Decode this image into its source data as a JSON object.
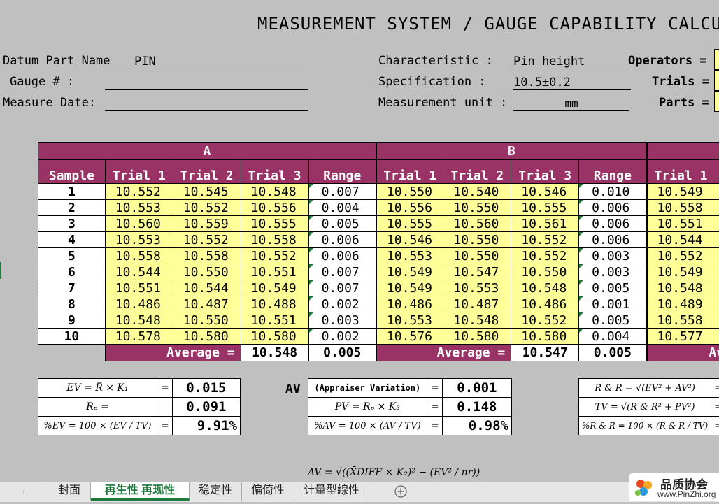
{
  "title": "MEASUREMENT SYSTEM / GAUGE CAPABILITY CALCUL",
  "header": {
    "datum_label": "Datum Part Name",
    "datum_value": "PIN",
    "gauge_label": "Gauge # :",
    "gauge_value": "",
    "date_label": "Measure Date:",
    "date_value": "",
    "char_label": "Characteristic :",
    "char_value": "Pin height",
    "spec_label": "Specification :",
    "spec_value": "10.5±0.2",
    "unit_label": "Measurement unit :",
    "unit_value": "mm",
    "operators_label": "Operators =",
    "trials_label": "Trials =",
    "parts_label": "Parts ="
  },
  "table": {
    "group_a": "A",
    "group_b": "B",
    "col_sample": "Sample",
    "col_trial1": "Trial 1",
    "col_trial2": "Trial 2",
    "col_trial3": "Trial 3",
    "col_range": "Range",
    "rows": [
      {
        "s": "1",
        "a1": "10.552",
        "a2": "10.545",
        "a3": "10.548",
        "ar": "0.007",
        "b1": "10.550",
        "b2": "10.540",
        "b3": "10.546",
        "br": "0.010",
        "c1": "10.549"
      },
      {
        "s": "2",
        "a1": "10.553",
        "a2": "10.552",
        "a3": "10.556",
        "ar": "0.004",
        "b1": "10.556",
        "b2": "10.550",
        "b3": "10.555",
        "br": "0.006",
        "c1": "10.558"
      },
      {
        "s": "3",
        "a1": "10.560",
        "a2": "10.559",
        "a3": "10.555",
        "ar": "0.005",
        "b1": "10.555",
        "b2": "10.560",
        "b3": "10.561",
        "br": "0.006",
        "c1": "10.551"
      },
      {
        "s": "4",
        "a1": "10.553",
        "a2": "10.552",
        "a3": "10.558",
        "ar": "0.006",
        "b1": "10.546",
        "b2": "10.550",
        "b3": "10.552",
        "br": "0.006",
        "c1": "10.544"
      },
      {
        "s": "5",
        "a1": "10.558",
        "a2": "10.558",
        "a3": "10.552",
        "ar": "0.006",
        "b1": "10.553",
        "b2": "10.550",
        "b3": "10.552",
        "br": "0.003",
        "c1": "10.552"
      },
      {
        "s": "6",
        "a1": "10.544",
        "a2": "10.550",
        "a3": "10.551",
        "ar": "0.007",
        "b1": "10.549",
        "b2": "10.547",
        "b3": "10.550",
        "br": "0.003",
        "c1": "10.549"
      },
      {
        "s": "7",
        "a1": "10.551",
        "a2": "10.544",
        "a3": "10.549",
        "ar": "0.007",
        "b1": "10.549",
        "b2": "10.553",
        "b3": "10.548",
        "br": "0.005",
        "c1": "10.548"
      },
      {
        "s": "8",
        "a1": "10.486",
        "a2": "10.487",
        "a3": "10.488",
        "ar": "0.002",
        "b1": "10.486",
        "b2": "10.487",
        "b3": "10.486",
        "br": "0.001",
        "c1": "10.489"
      },
      {
        "s": "9",
        "a1": "10.548",
        "a2": "10.550",
        "a3": "10.551",
        "ar": "0.003",
        "b1": "10.553",
        "b2": "10.548",
        "b3": "10.552",
        "br": "0.005",
        "c1": "10.558"
      },
      {
        "s": "10",
        "a1": "10.578",
        "a2": "10.580",
        "a3": "10.580",
        "ar": "0.002",
        "b1": "10.576",
        "b2": "10.580",
        "b3": "10.580",
        "br": "0.004",
        "c1": "10.577"
      }
    ],
    "avg_label": "Average =",
    "avg_label_short": "Av",
    "avg_a": "10.548",
    "avg_a_range": "0.005",
    "avg_b": "10.547",
    "avg_b_range": "0.005"
  },
  "summary": {
    "ev_formula": "EV = R̿ × K₁",
    "ev_value": "0.015",
    "rp_formula": "Rₚ =",
    "rp_value": "0.091",
    "pev_formula": "%EV = 100 × (EV / TV)",
    "pev_value": "9.91%",
    "av_label": "AV",
    "av_formula": "(Appraiser Variation)",
    "av_value": "0.001",
    "pv_formula": "PV = Rₚ × K₃",
    "pv_value": "0.148",
    "pav_formula": "%AV = 100 × (AV / TV)",
    "pav_value": "0.98%",
    "rr_formula": "R & R = √(EV² + AV²)",
    "tv_formula": "TV = √(R & R² + PV²)",
    "prr_formula": "%R & R = 100 × (R & R / TV)",
    "bottom_formula": "AV = √((X̄DIFF × K₂)² − (EV² / nr))"
  },
  "tabs": [
    "封面",
    "再生性 再现性",
    "稳定性",
    "偏倚性",
    "计量型線性"
  ],
  "active_tab": 1,
  "logo": {
    "name": "品质协会",
    "url": "www.PinZhi.org"
  },
  "colors": {
    "header": "#993366",
    "input": "#ffff99",
    "active_tab": "#1d7a3a"
  }
}
